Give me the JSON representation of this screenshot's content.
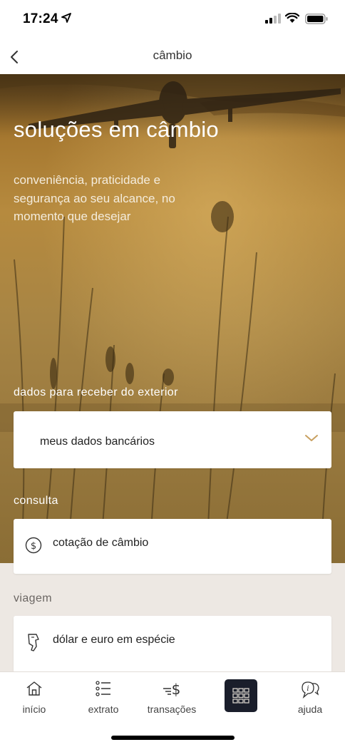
{
  "status_bar": {
    "time": "17:24"
  },
  "nav": {
    "title": "câmbio"
  },
  "hero": {
    "title": "soluções em câmbio",
    "subtitle": "conveniência, praticidade e segurança ao seu alcance, no momento que desejar"
  },
  "sections": {
    "receive": {
      "label": "dados para receber do exterior",
      "card": "meus dados bancários"
    },
    "consulta": {
      "label": "consulta",
      "card": "cotação de câmbio"
    },
    "viagem": {
      "label": "viagem",
      "card": "dólar e euro em espécie"
    }
  },
  "tab_bar": {
    "items": [
      {
        "label": "início",
        "icon": "home-icon"
      },
      {
        "label": "extrato",
        "icon": "list-icon"
      },
      {
        "label": "transações",
        "icon": "transfer-money-icon"
      },
      {
        "label": "",
        "icon": "grid-menu-icon"
      },
      {
        "label": "ajuda",
        "icon": "help-chat-icon"
      }
    ]
  },
  "colors": {
    "hero_gold": "#9c7a3c",
    "lower_bg": "#ede8e3",
    "accent_chevron": "#c8a060",
    "tab_center_bg": "#1a1e2b"
  }
}
